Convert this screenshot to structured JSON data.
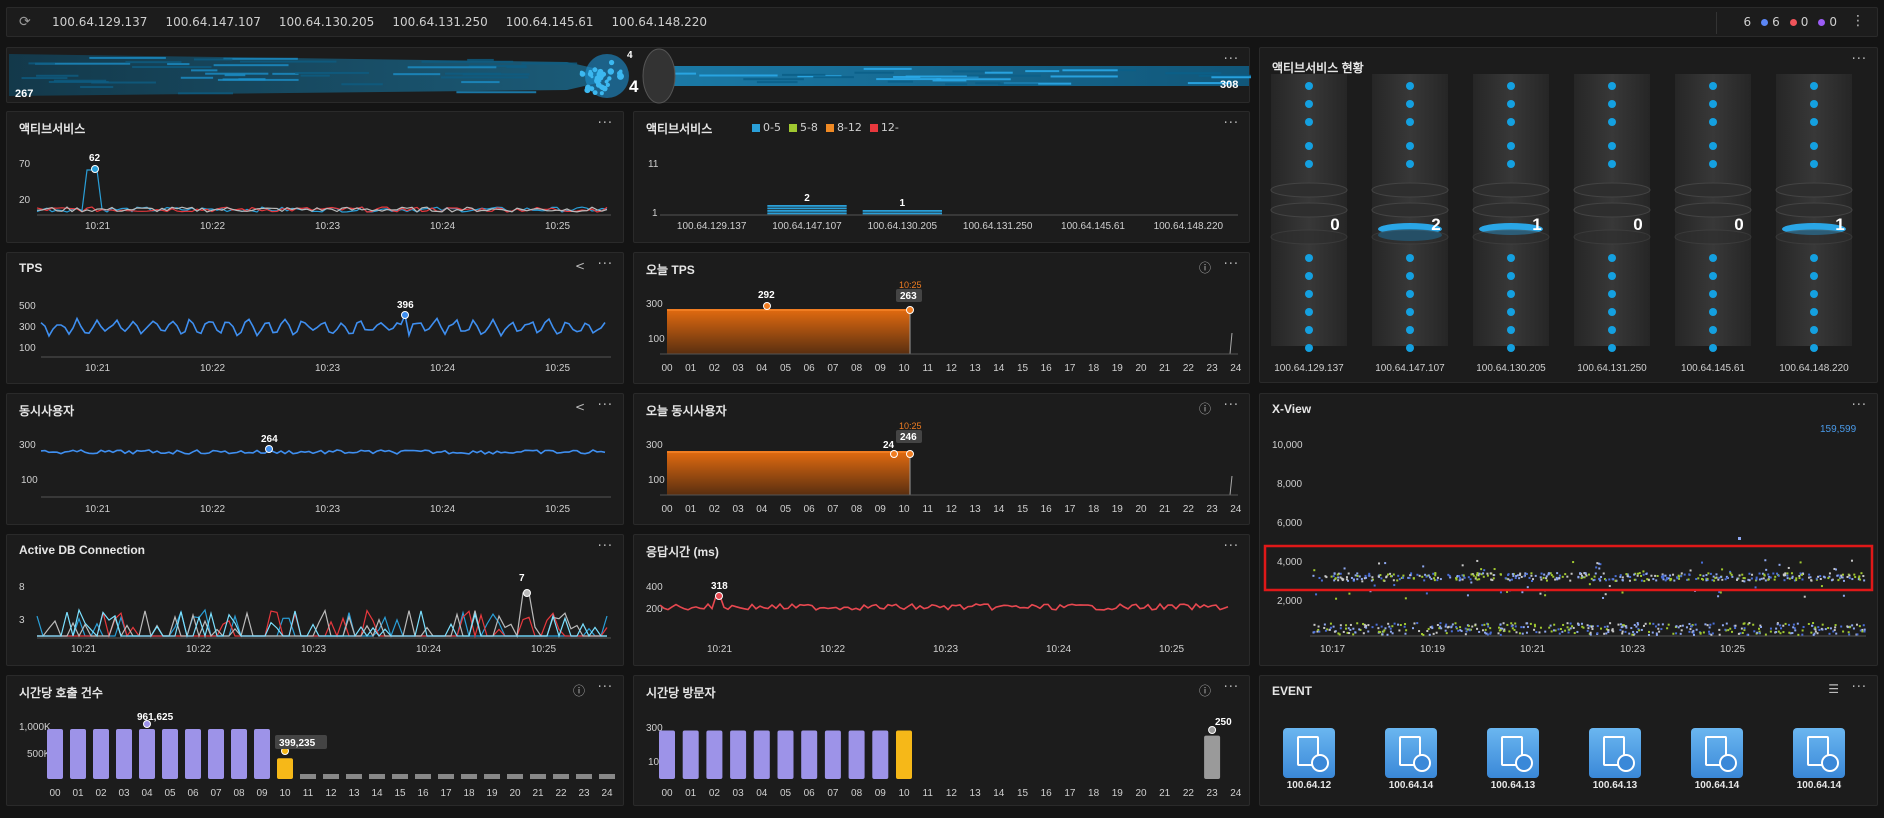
{
  "topbar": {
    "ips": [
      "100.64.129.137",
      "100.64.147.107",
      "100.64.130.205",
      "100.64.131.250",
      "100.64.145.61",
      "100.64.148.220"
    ],
    "stats": {
      "total": "6",
      "blue": "6",
      "red": "0",
      "purple": "0"
    },
    "colors": {
      "blue": "#5b86f5",
      "red": "#f0545a",
      "purple": "#9b5cf5"
    }
  },
  "flow": {
    "left_count": "267",
    "center_top": "4",
    "center_count": "4",
    "right_count": "308"
  },
  "active_service": {
    "title": "액티브서비스",
    "yticks": [
      "70",
      "20"
    ],
    "xticks": [
      "10:21",
      "10:22",
      "10:23",
      "10:24",
      "10:25"
    ],
    "peak_label": "62"
  },
  "active_service_bar": {
    "title": "액티브서비스",
    "legend": [
      {
        "label": "0-5",
        "color": "#2a9fd8"
      },
      {
        "label": "5-8",
        "color": "#a0c830"
      },
      {
        "label": "8-12",
        "color": "#f08a24"
      },
      {
        "label": "12-",
        "color": "#e8383d"
      }
    ],
    "yticks": [
      "11",
      "1"
    ],
    "chart_data": {
      "type": "bar",
      "categories": [
        "100.64.129.137",
        "100.64.147.107",
        "100.64.130.205",
        "100.64.131.250",
        "100.64.145.61",
        "100.64.148.220"
      ],
      "values": [
        0,
        2,
        1,
        0,
        0,
        0
      ],
      "ylim": [
        1,
        11
      ]
    }
  },
  "active_status": {
    "title": "액티브서비스 현황",
    "hosts": [
      "100.64.129.137",
      "100.64.147.107",
      "100.64.130.205",
      "100.64.131.250",
      "100.64.145.61",
      "100.64.148.220"
    ],
    "values": [
      "0",
      "2",
      "1",
      "0",
      "0",
      "1"
    ]
  },
  "tps": {
    "title": "TPS",
    "yticks": [
      "500",
      "300",
      "100"
    ],
    "xticks": [
      "10:21",
      "10:22",
      "10:23",
      "10:24",
      "10:25"
    ],
    "peak_label": "396"
  },
  "today_tps": {
    "title": "오늘 TPS",
    "yticks": [
      "300",
      "100"
    ],
    "hours": [
      "00",
      "01",
      "02",
      "03",
      "04",
      "05",
      "06",
      "07",
      "08",
      "09",
      "10",
      "11",
      "12",
      "13",
      "14",
      "15",
      "16",
      "17",
      "18",
      "19",
      "20",
      "21",
      "22",
      "23",
      "24"
    ],
    "peak_label": "292",
    "current_label": "263",
    "time_label": "10:25"
  },
  "users": {
    "title": "동시사용자",
    "yticks": [
      "300",
      "100"
    ],
    "xticks": [
      "10:21",
      "10:22",
      "10:23",
      "10:24",
      "10:25"
    ],
    "peak_label": "264"
  },
  "today_users": {
    "title": "오늘 동시사용자",
    "yticks": [
      "300",
      "100"
    ],
    "hours": [
      "00",
      "01",
      "02",
      "03",
      "04",
      "05",
      "06",
      "07",
      "08",
      "09",
      "10",
      "11",
      "12",
      "13",
      "14",
      "15",
      "16",
      "17",
      "18",
      "19",
      "20",
      "21",
      "22",
      "23",
      "24"
    ],
    "label_a": "24",
    "label_b": "246",
    "time_label": "10:25"
  },
  "xview": {
    "title": "X-View",
    "count": "159,599",
    "yticks": [
      "10,000",
      "8,000",
      "6,000",
      "4,000",
      "2,000"
    ],
    "xticks": [
      "10:17",
      "10:19",
      "10:21",
      "10:23",
      "10:25"
    ]
  },
  "db": {
    "title": "Active DB Connection",
    "yticks": [
      "8",
      "3"
    ],
    "xticks": [
      "10:21",
      "10:22",
      "10:23",
      "10:24",
      "10:25"
    ],
    "peak_label": "7"
  },
  "resp": {
    "title": "응답시간 (ms)",
    "yticks": [
      "400",
      "200"
    ],
    "xticks": [
      "10:21",
      "10:22",
      "10:23",
      "10:24",
      "10:25"
    ],
    "peak_label": "318"
  },
  "hourly_calls": {
    "title": "시간당 호출 건수",
    "yticks": [
      "1,000K",
      "500K"
    ],
    "hours": [
      "00",
      "01",
      "02",
      "03",
      "04",
      "05",
      "06",
      "07",
      "08",
      "09",
      "10",
      "11",
      "12",
      "13",
      "14",
      "15",
      "16",
      "17",
      "18",
      "19",
      "20",
      "21",
      "22",
      "23",
      "24"
    ],
    "label_a": "961,625",
    "label_b": "399,235",
    "chart_data": {
      "type": "bar",
      "categories": [
        "00",
        "01",
        "02",
        "03",
        "04",
        "05",
        "06",
        "07",
        "08",
        "09",
        "10"
      ],
      "values": [
        961625,
        961625,
        961625,
        961625,
        961625,
        961625,
        961625,
        961625,
        961625,
        961625,
        399235
      ],
      "ylim": [
        0,
        1000000
      ]
    }
  },
  "hourly_visitors": {
    "title": "시간당 방문자",
    "yticks": [
      "300",
      "100"
    ],
    "hours": [
      "00",
      "01",
      "02",
      "03",
      "04",
      "05",
      "06",
      "07",
      "08",
      "09",
      "10",
      "11",
      "12",
      "13",
      "14",
      "15",
      "16",
      "17",
      "18",
      "19",
      "20",
      "21",
      "22",
      "23",
      "24"
    ],
    "label": "250",
    "chart_data": {
      "type": "bar",
      "categories": [
        "00",
        "01",
        "02",
        "03",
        "04",
        "05",
        "06",
        "07",
        "08",
        "09",
        "10",
        "23"
      ],
      "values": [
        280,
        280,
        280,
        280,
        280,
        280,
        280,
        280,
        280,
        280,
        280,
        250
      ],
      "ylim": [
        0,
        300
      ]
    }
  },
  "event": {
    "title": "EVENT",
    "items": [
      "100.64.12",
      "100.64.14",
      "100.64.13",
      "100.64.13",
      "100.64.14",
      "100.64.14"
    ]
  }
}
